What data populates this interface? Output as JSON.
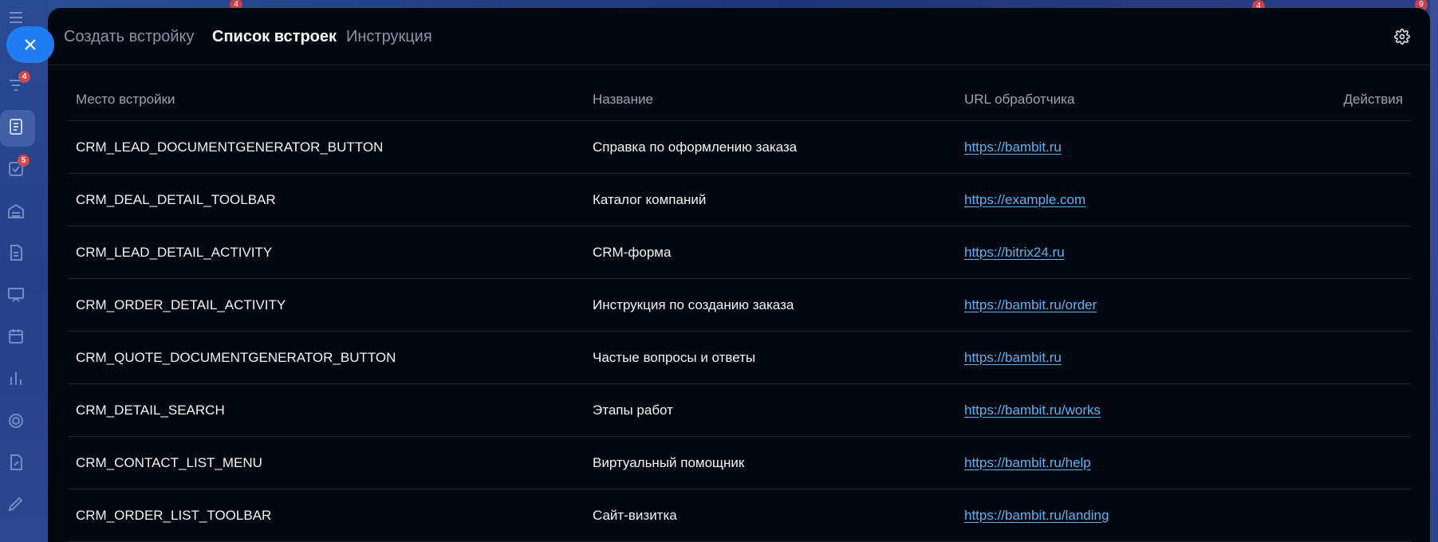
{
  "colors": {
    "panel_bg": "#03070f",
    "accent_blue": "#1f7df1",
    "link": "#5fb2f3",
    "badge_red": "#d8454c"
  },
  "sidebar": {
    "badges": [
      "4",
      "5"
    ]
  },
  "top_peek_badges": [
    "4",
    "4",
    "9"
  ],
  "header": {
    "tabs": [
      {
        "label": "Создать встройку",
        "active": false
      },
      {
        "label": "Список встроек",
        "active": true
      },
      {
        "label": "Инструкция",
        "active": false
      }
    ],
    "settings_icon": "gear-icon",
    "close_icon": "close-icon"
  },
  "table": {
    "columns": [
      "Место встройки",
      "Название",
      "URL обработчика",
      "Действия"
    ],
    "rows": [
      {
        "place": "CRM_LEAD_DOCUMENTGENERATOR_BUTTON",
        "name": "Справка по оформлению заказа",
        "url": "https://bambit.ru"
      },
      {
        "place": "CRM_DEAL_DETAIL_TOOLBAR",
        "name": "Каталог компаний",
        "url": "https://example.com"
      },
      {
        "place": "CRM_LEAD_DETAIL_ACTIVITY",
        "name": "CRM-форма",
        "url": "https://bitrix24.ru"
      },
      {
        "place": "CRM_ORDER_DETAIL_ACTIVITY",
        "name": "Инструкция по созданию заказа",
        "url": "https://bambit.ru/order"
      },
      {
        "place": "CRM_QUOTE_DOCUMENTGENERATOR_BUTTON",
        "name": "Частые вопросы и ответы",
        "url": "https://bambit.ru"
      },
      {
        "place": "CRM_DETAIL_SEARCH",
        "name": "Этапы работ",
        "url": "https://bambit.ru/works"
      },
      {
        "place": "CRM_CONTACT_LIST_MENU",
        "name": "Виртуальный помощник",
        "url": "https://bambit.ru/help"
      },
      {
        "place": "CRM_ORDER_LIST_TOOLBAR",
        "name": "Сайт-визитка",
        "url": "https://bambit.ru/landing"
      }
    ]
  }
}
